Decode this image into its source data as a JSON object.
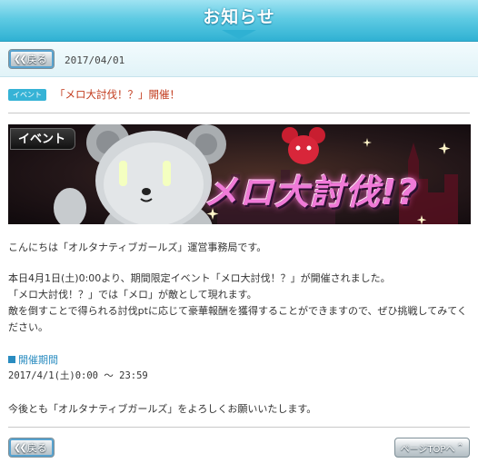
{
  "header": {
    "title": "お知らせ"
  },
  "nav": {
    "back_label": "戻る",
    "date": "2017/04/01"
  },
  "article": {
    "tag": "イベント",
    "title": "「メロ大討伐！？」開催！",
    "banner": {
      "badge": "イベント",
      "logo_text": "メロ大討伐!?"
    },
    "paragraphs": [
      "こんにちは「オルタナティブガールズ」運営事務局です。",
      "本日4月1日(土)0:00より、期間限定イベント「メロ大討伐！？」が開催されました。",
      "「メロ大討伐！？」では「メロ」が敵として現れます。",
      "敵を倒すことで得られる討伐ptに応じて豪華報酬を獲得することができますので、ぜひ挑戦してみてく",
      "ださい。"
    ],
    "period_heading": "開催期間",
    "period_value": "2017/4/1(土)0:00 ～ 23:59",
    "closing": "今後とも「オルタナティブガールズ」をよろしくお願いいたします。"
  },
  "footer": {
    "back_label": "戻る",
    "top_label": "ページTOPへ"
  },
  "colors": {
    "header": "#2fb1d3",
    "tag": "#36b3d6",
    "title": "#c23a1c",
    "heading": "#2a8cc0"
  }
}
